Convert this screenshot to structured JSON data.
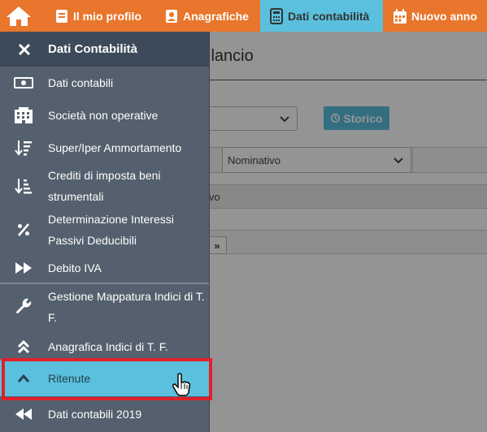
{
  "topnav": {
    "items": [
      {
        "label": "",
        "icon": "home-icon"
      },
      {
        "label": "Il mio profilo",
        "icon": "book-icon"
      },
      {
        "label": "Anagrafiche",
        "icon": "contact-card-icon"
      },
      {
        "label": "Dati contabilità",
        "icon": "calculator-icon"
      },
      {
        "label": "Nuovo anno",
        "icon": "calendar-icon"
      }
    ],
    "active_index": 3
  },
  "background": {
    "title_fragment": "ilancio",
    "storico_label": "Storico",
    "filter_select": "Nominativo",
    "row_text": "vo",
    "pager_label": "»"
  },
  "menu": {
    "header": "Dati Contabilità",
    "items": [
      {
        "label": "Dati contabili",
        "icon": "money-icon"
      },
      {
        "label": "Società non operative",
        "icon": "building-icon"
      },
      {
        "label": "Super/Iper Ammortamento",
        "icon": "sort-amount-down-icon"
      },
      {
        "label": "Crediti di imposta beni strumentali",
        "icon": "sort-amount-up-icon"
      },
      {
        "label": "Determinazione Interessi Passivi Deducibili",
        "icon": "percent-icon"
      },
      {
        "label": "Debito IVA",
        "icon": "fast-forward-icon"
      },
      {
        "label": "Gestione Mappatura Indici di T. F.",
        "icon": "wrench-icon"
      },
      {
        "label": "Anagrafica Indici di T. F.",
        "icon": "double-chevron-up-icon"
      },
      {
        "label": "Ritenute",
        "icon": "chevron-up-icon"
      },
      {
        "label": "Dati contabili 2019",
        "icon": "fast-backward-icon"
      }
    ],
    "selected_index": 8
  },
  "colors": {
    "nav_orange": "#e8762c",
    "nav_active": "#5bc0de",
    "menu_bg": "#54606d",
    "menu_header_bg": "#3c4a5a",
    "highlight_red": "#e0202a"
  }
}
